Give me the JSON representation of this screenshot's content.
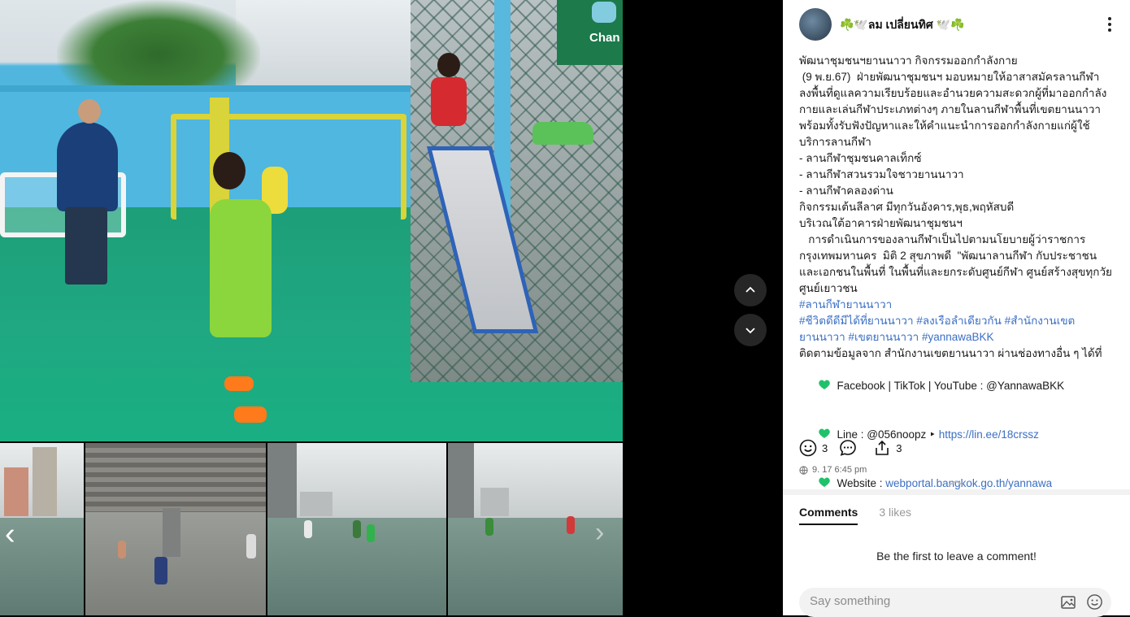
{
  "post": {
    "author": "☘️🕊️ลม เปลี่ยนทิศ 🕊️☘️",
    "body_lines": [
      "พัฒนาชุมชนฯยานนาวา กิจกรรมออกกำลังกาย",
      " (9 พ.ย.67)  ฝ่ายพัฒนาชุมชนฯ มอบหมายให้อาสาสมัครลานกีฬา ลงพื้นที่ดูแลความเรียบร้อยและอำนวยความสะดวกผู้ที่มาออกกำลังกายและเล่นกีฬาประเภทต่างๆ ภายในลานกีฬาพื้นที่เขตยานนาวา พร้อมทั้งรับฟังปัญหาและให้คำแนะนำการออกกำลังกายแก่ผู้ใช้บริการลานกีฬา",
      "- ลานกีฬาชุมชนคาลเท็กซ์",
      "- ลานกีฬาสวนรวมใจชาวยานนาวา",
      "- ลานกีฬาคลองด่าน",
      "กิจกรรมเต้นลีลาศ มีทุกวันอังคาร,พุธ,พฤหัสบดี",
      "บริเวณใต้อาคารฝ่ายพัฒนาชุมชนฯ",
      "   การดำเนินการของลานกีฬาเป็นไปตามนโยบายผู้ว่าราชการกรุงเทพมหานคร  มิติ 2 สุขภาพดี  \"พัฒนาลานกีฬา กับประชาชนและเอกชนในพื้นที่ ในพื้นที่และยกระดับศูนย์กีฬา ศูนย์สร้างสุขทุกวัย ศูนย์เยาวชน"
    ],
    "hashtag_1": "#ลานกีฬายานนาวา",
    "hashtags_2": "#ชีวิตดีดีมีได้ที่ยานนาวา #ลงเรือลำเดียวกัน #สำนักงานเขตยานนาวา #เขตยานนาวา #yannawaBKK",
    "follow_text": "ติดตามข้อมูลจาก สำนักงานเขตยานนาวา ผ่านช่องทางอื่น ๆ ได้ที่",
    "contact_1": "Facebook | TikTok | YouTube : @YannawaBKK",
    "contact_2_text": "Line : @056noopz ‣ ",
    "contact_2_link": "https://lin.ee/18crssz",
    "contact_3_text": "Website : ",
    "contact_3_link": "webportal.bangkok.go.th/yannawa",
    "reactions": {
      "emoji_count": "3",
      "comment_count": "",
      "share_count": "3"
    },
    "timestamp": "9. 17 6:45 pm",
    "sign_text": "Chan"
  },
  "comments": {
    "tab_comments": "Comments",
    "tab_likes": "3 likes",
    "empty_text": "Be the first to leave a comment!",
    "input_placeholder": "Say something"
  },
  "colors": {
    "accent_link": "#3b6fc4",
    "heart": "#1ec26b"
  },
  "icons": [
    "more-vertical-icon",
    "chevron-up-icon",
    "chevron-down-icon",
    "chevron-left-icon",
    "chevron-right-icon",
    "smiley-icon",
    "comment-icon",
    "share-icon",
    "globe-icon",
    "image-icon",
    "emoji-icon",
    "green-heart-icon"
  ]
}
